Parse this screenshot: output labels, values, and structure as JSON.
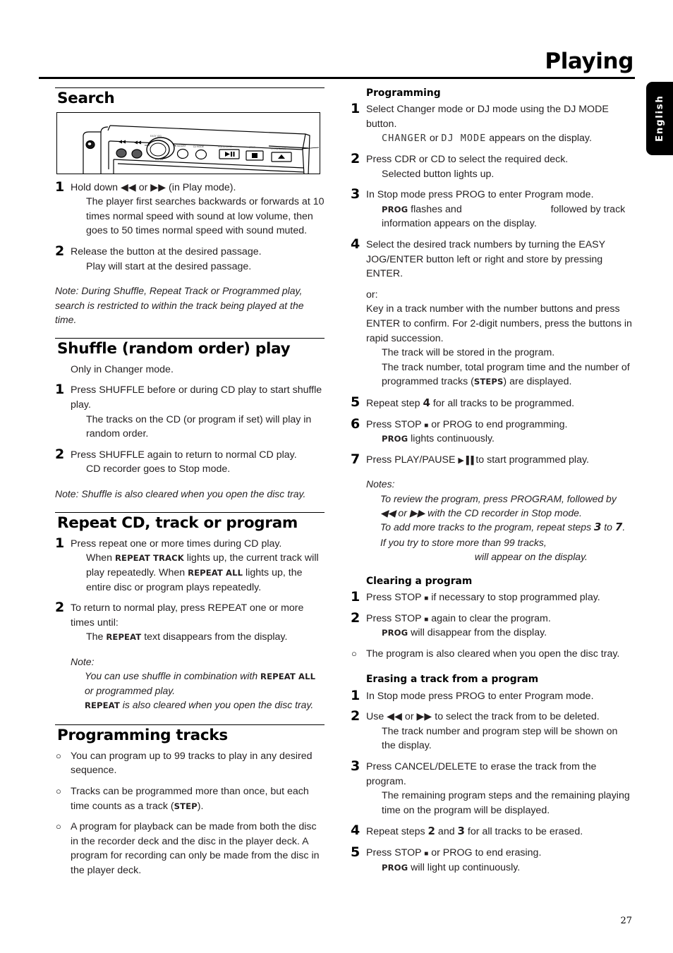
{
  "header": {
    "title": "Playing",
    "side_tab": "English"
  },
  "footer": {
    "page_number": "27"
  },
  "left_column": {
    "search": {
      "title": "Search",
      "illustration_alt": "cd-recorder-front-panel",
      "steps": [
        {
          "num": "1",
          "main": "Hold down ◀◀ or ▶▶ (in Play mode).",
          "sub": "The player first searches backwards or forwards at 10 times normal speed  with sound at low volume, then goes to 50 times normal speed with sound muted."
        },
        {
          "num": "2",
          "main": "Release the button at the desired passage.",
          "sub": "Play will start at the desired passage."
        }
      ],
      "note": "Note: During Shuffle, Repeat Track or Programmed play, search is restricted to within the track being played at the time."
    },
    "shuffle": {
      "title": "Shuffle (random order) play",
      "intro": "Only in Changer mode.",
      "steps": [
        {
          "num": "1",
          "main": "Press SHUFFLE before or during CD play to start shuffle play.",
          "sub": "The tracks on the CD (or program if set) will play in random order."
        },
        {
          "num": "2",
          "main": "Press SHUFFLE again to return to normal CD play.",
          "sub": "CD recorder goes to Stop mode."
        }
      ],
      "note": "Note: Shuffle is also cleared when you open the disc tray."
    },
    "repeat": {
      "title": "Repeat CD, track or program",
      "step1_num": "1",
      "step1_main": "Press repeat one or more times during CD play.",
      "step1_sub_a": "When ",
      "step1_sc_a": "REPEAT TRACK",
      "step1_sub_b": " lights up, the current track will play repeatedly. When ",
      "step1_sc_b": "REPEAT ALL",
      "step1_sub_c": " lights up, the entire disc or program plays repeatedly.",
      "step2_num": "2",
      "step2_main": "To return to normal play, press REPEAT one or more times until:",
      "step2_sub_a": "The ",
      "step2_sc": "REPEAT",
      "step2_sub_b": " text disappears from the display.",
      "note_label": "Note:",
      "note_a": "You can use shuffle in combination with ",
      "note_sc_a": "REPEAT ALL",
      "note_b": " or programmed play.",
      "note_sc_b": "REPEAT",
      "note_c": " is also cleared when you open the disc tray."
    },
    "programming_tracks": {
      "title": "Programming tracks",
      "bullet_glyph": "○",
      "items": [
        {
          "text_a": "You can program up to 99 tracks to play in any desired sequence.",
          "sc": "",
          "text_b": ""
        },
        {
          "text_a": "Tracks can be programmed more than once, but each time counts as a track (",
          "sc": "STEP",
          "text_b": ")."
        },
        {
          "text_a": "A program for playback can be made from both the disc in the recorder deck and the disc in the player deck. A program for recording can only be made from the disc in the player deck.",
          "sc": "",
          "text_b": ""
        }
      ]
    }
  },
  "right_column": {
    "programming": {
      "title": "Programming",
      "s1_num": "1",
      "s1_main": "Select Changer mode or DJ mode using the DJ MODE button.",
      "s1_lcd_a": "CHANGER",
      "s1_mid": " or ",
      "s1_lcd_b": "DJ MODE",
      "s1_tail": " appears on the display.",
      "s2_num": "2",
      "s2_main": "Press CDR or CD to select the required deck.",
      "s2_sub": "Selected button lights up.",
      "s3_num": "3",
      "s3_main": "In Stop mode press PROG to enter Program mode.",
      "s3_sc": "PROG",
      "s3_sub_a": " flashes and ",
      "s3_sub_b": " followed by track information appears on the display.",
      "s4_num": "4",
      "s4_main": "Select the desired track numbers by turning the EASY JOG/ENTER button left or right and store by pressing ENTER.",
      "s4_or": "or:",
      "s4_alt": "Key in a track number with the number buttons and press ENTER to confirm. For 2-digit numbers, press the buttons in rapid succession.",
      "s4_sub_1": "The track will be stored in the program.",
      "s4_sub_2a": "The track number, total program time and the number of programmed tracks (",
      "s4_sub_sc": "STEPS",
      "s4_sub_2b": ") are displayed.",
      "s5_num": "5",
      "s5_a": "Repeat step ",
      "s5_ref": "4",
      "s5_b": " for all tracks to be programmed.",
      "s6_num": "6",
      "s6_main_a": "Press STOP ",
      "s6_glyph": "■",
      "s6_main_b": " or PROG to end programming.",
      "s6_sc": "PROG",
      "s6_sub": " lights continuously.",
      "s7_num": "7",
      "s7_main_a": "Press PLAY/PAUSE ",
      "s7_glyph": "▶▐▐",
      "s7_main_b": " to start programmed play.",
      "notes_label": "Notes:",
      "note_1": "To review the program, press PROGRAM, followed by ◀◀ or ▶▶ with the CD recorder in Stop mode.",
      "note_2a": "To add more tracks to the program, repeat steps ",
      "note_2ref1": "3",
      "note_2b": " to ",
      "note_2ref2": "7",
      "note_2c": ".",
      "note_3a": "If you try to store more than 99 tracks, ",
      "note_3b": " will appear on the display."
    },
    "clearing": {
      "title": "Clearing a program",
      "s1_num": "1",
      "s1_a": "Press STOP ",
      "s1_glyph": "■",
      "s1_b": " if necessary to stop programmed play.",
      "s2_num": "2",
      "s2_a": "Press STOP ",
      "s2_glyph": "■",
      "s2_b": " again to clear the program.",
      "s2_sc": "PROG",
      "s2_sub": " will disappear from the display.",
      "bullet_glyph": "○",
      "bullet_text": "The program is also cleared when you open the disc tray."
    },
    "erasing": {
      "title": "Erasing a track from a program",
      "s1_num": "1",
      "s1_main": "In Stop mode press PROG to enter Program mode.",
      "s2_num": "2",
      "s2_main": "Use ◀◀ or ▶▶ to select the track from to be deleted.",
      "s2_sub": "The track number and program step will be shown on the display.",
      "s3_num": "3",
      "s3_main": "Press CANCEL/DELETE to erase the track from the program.",
      "s3_sub": "The remaining program steps and the remaining playing time on the program will be displayed.",
      "s4_num": "4",
      "s4_a": "Repeat steps ",
      "s4_ref1": "2",
      "s4_b": " and ",
      "s4_ref2": "3",
      "s4_c": " for all tracks to be erased.",
      "s5_num": "5",
      "s5_a": "Press STOP ",
      "s5_glyph": "■",
      "s5_b": " or PROG to end erasing.",
      "s5_sc": "PROG",
      "s5_sub": " will light up continuously."
    }
  }
}
